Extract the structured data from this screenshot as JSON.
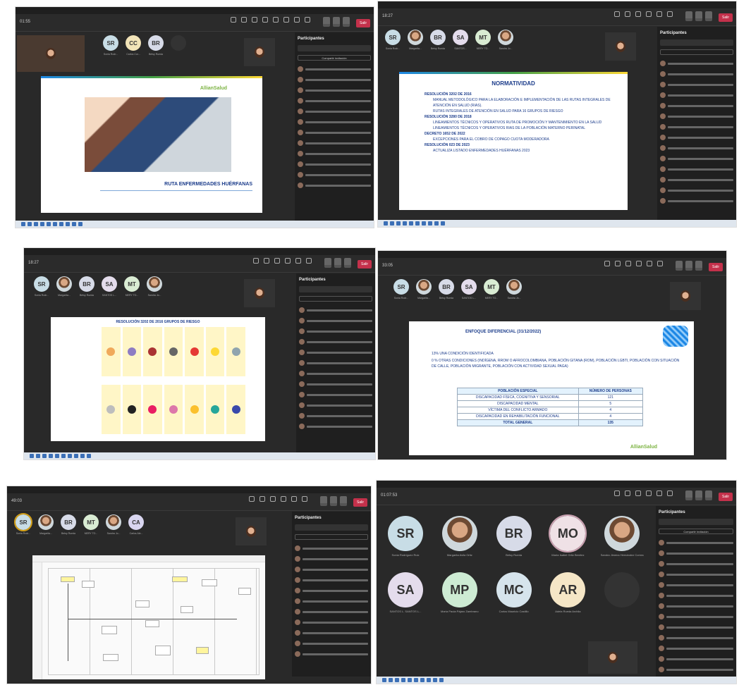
{
  "panels": {
    "p1": {
      "timer": "01:55",
      "avatars": [
        {
          "initials": "SR",
          "color": "#c8dde6",
          "name": "Sonia Rodr..."
        },
        {
          "initials": "CC",
          "color": "#f2e4b8",
          "name": "Carlos Cor..."
        },
        {
          "initials": "BR",
          "color": "#d7dbe8",
          "name": "Betsy Rueda"
        }
      ],
      "sidebar_title": "Participantes",
      "share_label": "Compartir invitación",
      "slide_brand": "AllianSalud",
      "slide_title": "RUTA ENFERMEDADES HUÉRFANAS"
    },
    "p2": {
      "timer": "18:27",
      "avatars": [
        {
          "initials": "SR",
          "color": "#c8dde6",
          "name": "Sonia Rodr..."
        },
        {
          "initials": "",
          "color": "photo",
          "name": "Margarita..."
        },
        {
          "initials": "BR",
          "color": "#d7dbe8",
          "name": "Betsy Rueda"
        },
        {
          "initials": "SA",
          "color": "#e4dcec",
          "name": "SANTOS..."
        },
        {
          "initials": "MT",
          "color": "#d9ecd3",
          "name": "MERY TO..."
        },
        {
          "initials": "",
          "color": "photo",
          "name": "Sandra Jo..."
        }
      ],
      "sidebar_title": "Participantes",
      "slide_title": "NORMATIVIDAD",
      "lines": [
        {
          "b": "RESOLUCIÓN 3202 DE 2016",
          "t": ""
        },
        {
          "b": "",
          "t": "MANUAL METODOLÓGICO PARA LA ELABORACIÓN E IMPLEMENTACIÓN DE LAS RUTAS INTEGRALES DE ATENCIÓN EN SALUD (RIAS)."
        },
        {
          "b": "",
          "t": "RUTAS INTEGRALES DE ATENCIÓN EN SALUD PARA 16 GRUPOS DE RIESGO"
        },
        {
          "b": "RESOLUCIÓN 3280 DE 2018",
          "t": ""
        },
        {
          "b": "",
          "t": "LINEAMIENTOS TÉCNICOS Y OPERATIVOS RUTA DE PROMOCIÓN Y MANTENIMIENTO EN LA SALUD"
        },
        {
          "b": "",
          "t": "LINEAMIENTOS TÉCNICOS Y OPERATIVOS RIAS DE LA POBLACIÓN MATERNO PERINATAL"
        },
        {
          "b": "DECRETO 1652 DE 2022",
          "t": ""
        },
        {
          "b": "",
          "t": "EXCEPCIONES PARA EL COBRO DE COPAGO CUOTA MODERADORA"
        },
        {
          "b": "RESOLUCIÓN 023 DE 2023",
          "t": ""
        },
        {
          "b": "",
          "t": "ACTUALIZA LISTADO ENFERMEDADES HUÉRFANAS 2023"
        }
      ]
    },
    "p3": {
      "timer": "18:27",
      "avatars": [
        {
          "initials": "SR",
          "color": "#c8dde6",
          "name": "Sonia Rodr..."
        },
        {
          "initials": "",
          "color": "photo",
          "name": "Margarita..."
        },
        {
          "initials": "BR",
          "color": "#d7dbe8",
          "name": "Betsy Rueda"
        },
        {
          "initials": "SA",
          "color": "#e4dcec",
          "name": "SANTOS L..."
        },
        {
          "initials": "MT",
          "color": "#d9ecd3",
          "name": "MERY TO..."
        },
        {
          "initials": "",
          "color": "photo",
          "name": "Sandra Jo..."
        }
      ],
      "sidebar_title": "Participantes",
      "slide_title": "RESOLUCIÓN 3202 DE 2016 GRUPOS DE RIESGO"
    },
    "p4": {
      "timer": "33:05",
      "avatars": [
        {
          "initials": "SR",
          "color": "#c8dde6",
          "name": "Sonia Rodr..."
        },
        {
          "initials": "",
          "color": "photo",
          "name": "Margarita..."
        },
        {
          "initials": "BR",
          "color": "#d7dbe8",
          "name": "Betsy Rueda"
        },
        {
          "initials": "SA",
          "color": "#e4dcec",
          "name": "SANTOS L..."
        },
        {
          "initials": "MT",
          "color": "#d9ecd3",
          "name": "MERY TO..."
        },
        {
          "initials": "",
          "color": "photo",
          "name": "Sandra Jo..."
        }
      ],
      "slide_title": "ENFOQUE DIFERENCIAL (31/12/2022)",
      "bullets": [
        "13% UNA CONDICIÓN IDENTIFICADA",
        "0 % OTRAS CONDICIONES (INDÍGENA, RROM O AFROCOLOMBIANA, POBLACIÓN GITANA (ROM), POBLACIÓN LGBTI, POBLACIÓN CON SITUACIÓN DE CALLE, POBLACIÓN MIGRANTE, POBLACIÓN CON ACTIVIDAD SEXUAL PAGA)"
      ],
      "table": {
        "headers": [
          "POBLACIÓN ESPECIAL",
          "NÚMERO DE PERSONAS"
        ],
        "rows": [
          [
            "DISCAPACIDAD FÍSICA, COGNITIVA Y SENSORIAL",
            "121"
          ],
          [
            "DISCAPACIDAD MENTAL",
            "5"
          ],
          [
            "VÍCTIMA DEL CONFLICTO ARMADO",
            "4"
          ],
          [
            "DISCAPACIDAD EN REHABILITACIÓN FUNCIONAL",
            "4"
          ],
          [
            "TOTAL GENERAL",
            "135"
          ]
        ]
      },
      "brand": "AllianSalud"
    },
    "p5": {
      "timer": "49:03",
      "avatars": [
        {
          "initials": "SR",
          "color": "#c8dde6",
          "name": "Sonia Rodr..."
        },
        {
          "initials": "",
          "color": "photo",
          "name": "Margarita..."
        },
        {
          "initials": "BR",
          "color": "#d7dbe8",
          "name": "Betsy Rueda"
        },
        {
          "initials": "MT",
          "color": "#d9ecd3",
          "name": "MERY TO..."
        },
        {
          "initials": "",
          "color": "photo",
          "name": "Sandra Jo..."
        },
        {
          "initials": "CA",
          "color": "#d9d6f0",
          "name": "Carlos Ale..."
        }
      ],
      "sidebar_title": "Participantes"
    },
    "p6": {
      "timer": "01:07:53",
      "avatars": [
        {
          "initials": "SR",
          "color": "#c8dde6",
          "name": "Sonia Rodríguez Ruiz"
        },
        {
          "initials": "",
          "color": "photo",
          "name": "Margarita Avila Ortiz"
        },
        {
          "initials": "BR",
          "color": "#d7dbe8",
          "name": "Betsy Rueda"
        },
        {
          "initials": "MO",
          "color": "#efe1e6",
          "name": "María Isabel Ortiz Benítez"
        },
        {
          "initials": "",
          "color": "photo",
          "name": "Sandra Jimena Hernández Correa"
        },
        {
          "initials": "SA",
          "color": "#e4dcec",
          "name": "SANTOS L. SANTOS L..."
        },
        {
          "initials": "MP",
          "color": "#cdebd3",
          "name": "María Paula Pájaro Zambrano"
        },
        {
          "initials": "MC",
          "color": "#d6e4ec",
          "name": "Carlos Mauricio Castillo"
        },
        {
          "initials": "AR",
          "color": "#f5e6c6",
          "name": "Adela Rueda Archila"
        }
      ],
      "sidebar_title": "Participantes",
      "share_label": "Compartir invitación"
    }
  }
}
